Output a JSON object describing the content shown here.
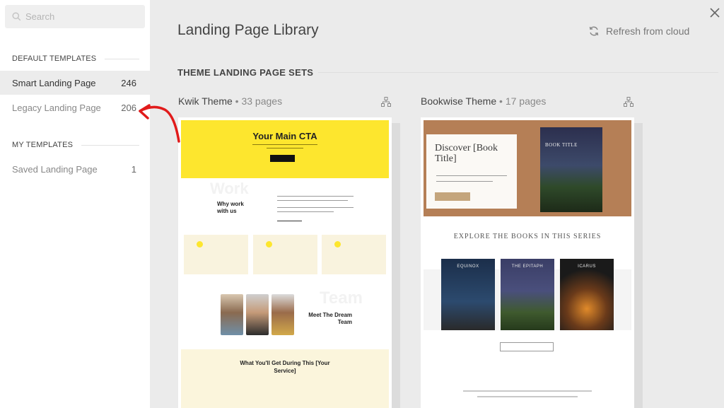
{
  "sidebar": {
    "search": {
      "placeholder": "Search"
    },
    "sections": [
      {
        "title": "DEFAULT TEMPLATES",
        "items": [
          {
            "label": "Smart Landing Page",
            "count": "246",
            "active": true
          },
          {
            "label": "Legacy Landing Page",
            "count": "206",
            "active": false
          }
        ]
      },
      {
        "title": "MY TEMPLATES",
        "items": [
          {
            "label": "Saved Landing Page",
            "count": "1",
            "active": false
          }
        ]
      }
    ]
  },
  "header": {
    "title": "Landing Page Library",
    "refresh_label": "Refresh from cloud"
  },
  "sets": {
    "heading": "THEME LANDING PAGE SETS",
    "themes": [
      {
        "name": "Kwik Theme",
        "pages": "33 pages",
        "preview": {
          "cta": "Your Main CTA",
          "work_bg": "Work",
          "why": "Why work with us",
          "team_bg": "Team",
          "meet": "Meet The Dream Team",
          "get": "What You'll Get During This [Your Service]"
        }
      },
      {
        "name": "Bookwise Theme",
        "pages": "17 pages",
        "preview": {
          "discover": "Discover [Book Title]",
          "book_title": "BOOK TITLE",
          "explore": "EXPLORE THE BOOKS IN THIS SERIES",
          "covers": [
            "EQUINOX",
            "THE EPITAPH",
            "ICARUS"
          ]
        }
      }
    ]
  },
  "colors": {
    "annotation": "#e11b1b",
    "kwik_yellow": "#fde62e",
    "sidebar_active": "#ececec"
  }
}
